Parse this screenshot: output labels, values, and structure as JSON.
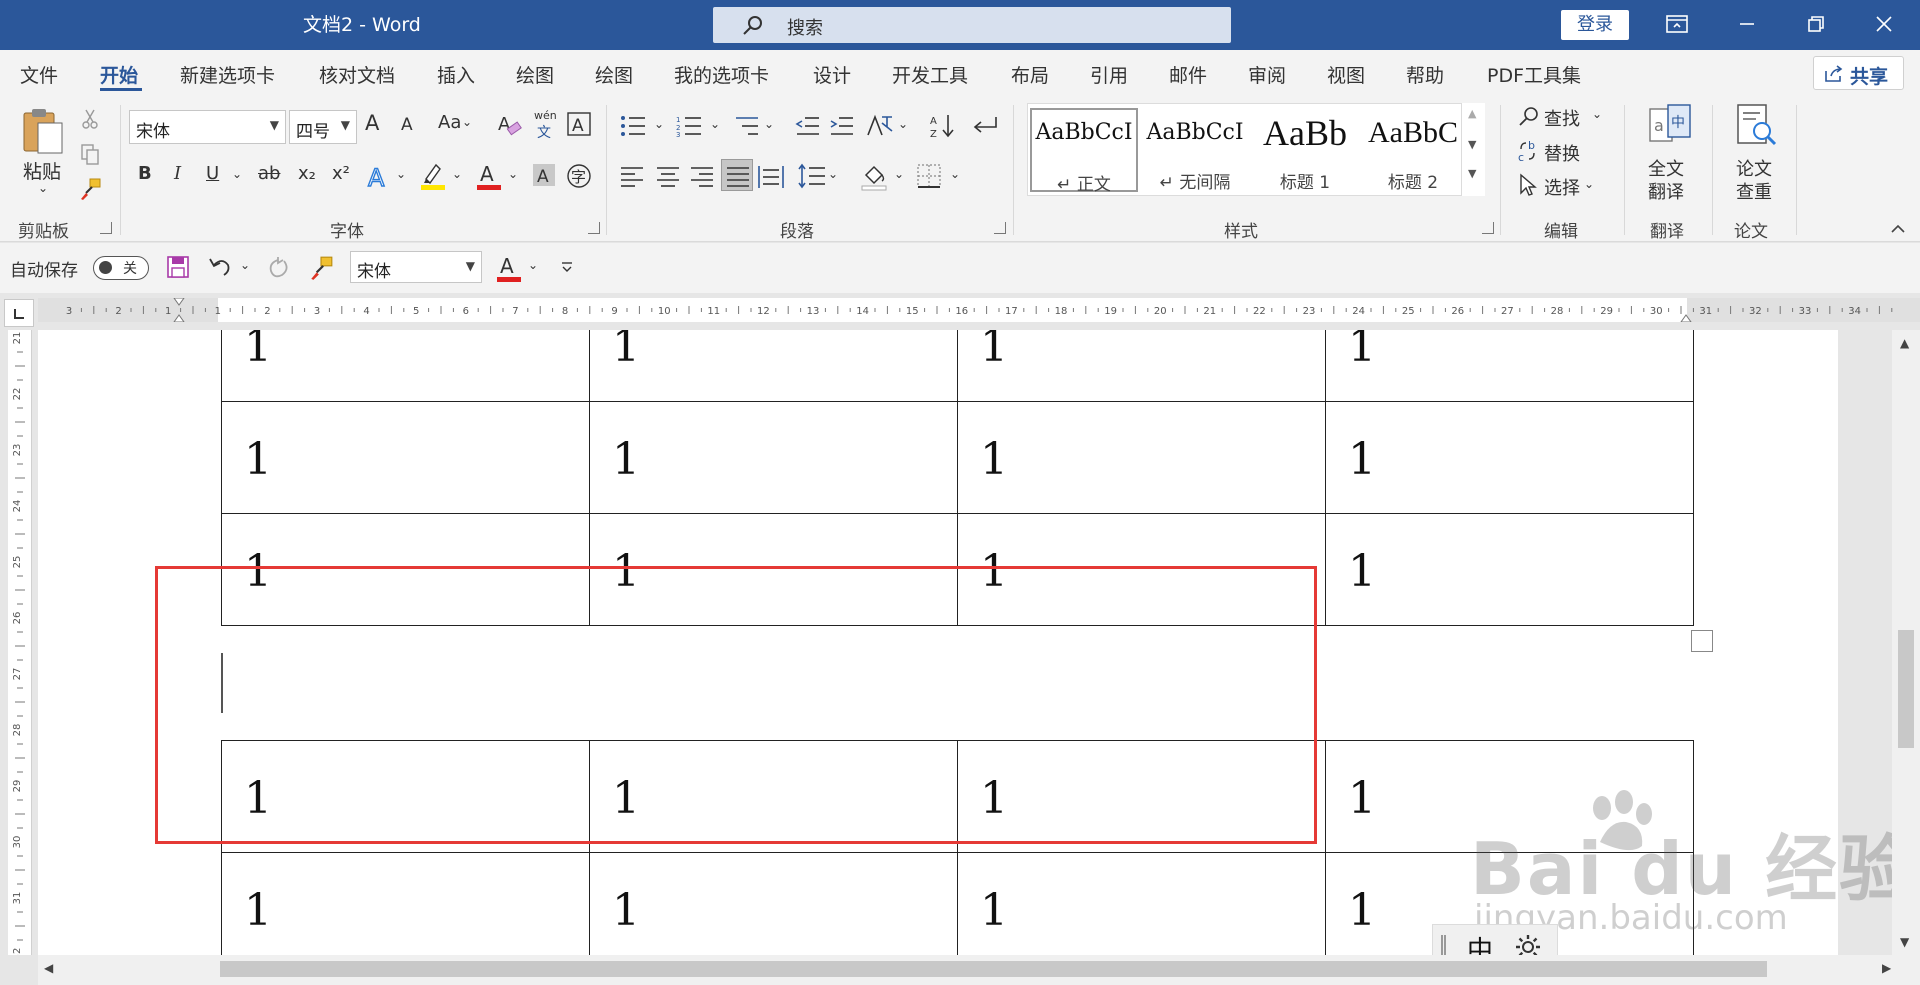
{
  "title_bar": {
    "doc_title": "文档2  -  Word",
    "search_placeholder": "搜索",
    "login_label": "登录"
  },
  "tabs": [
    "文件",
    "开始",
    "新建选项卡",
    "核对文档",
    "插入",
    "绘图",
    "绘图",
    "我的选项卡",
    "设计",
    "开发工具",
    "布局",
    "引用",
    "邮件",
    "审阅",
    "视图",
    "帮助",
    "PDF工具集"
  ],
  "active_tab": "开始",
  "share_label": "共享",
  "ribbon": {
    "clipboard": {
      "paste_label": "粘贴",
      "group_label": "剪贴板"
    },
    "font": {
      "font_name": "宋体",
      "font_size": "四号",
      "group_label": "字体",
      "bold": "B",
      "italic": "I",
      "underline": "U",
      "strike": "ab",
      "subscript": "x₂",
      "superscript": "x²",
      "change_case": "Aa",
      "grow": "A",
      "shrink": "A",
      "font_color_hex": "#e02020",
      "highlight_color_hex": "#ffe600",
      "pinyin": "wén",
      "pinyin_char": "文"
    },
    "paragraph": {
      "group_label": "段落"
    },
    "styles": {
      "group_label": "样式",
      "items": [
        {
          "sample": "AaBbCcI",
          "name": "↵ 正文"
        },
        {
          "sample": "AaBbCcI",
          "name": "↵ 无间隔"
        },
        {
          "sample": "AaBb",
          "name": "标题 1"
        },
        {
          "sample": "AaBbC",
          "name": "标题 2"
        }
      ]
    },
    "editing": {
      "find": "查找",
      "replace": "替换",
      "select": "选择",
      "group_label": "编辑"
    },
    "translate": {
      "label_line1": "全文",
      "label_line2": "翻译",
      "group_label": "翻译"
    },
    "thesis": {
      "label_line1": "论文",
      "label_line2": "查重",
      "group_label": "论文"
    }
  },
  "qat": {
    "autosave_label": "自动保存",
    "autosave_state": "关",
    "font_name": "宋体"
  },
  "document": {
    "table_top_rows": [
      [
        "1",
        "1",
        "1",
        "1"
      ],
      [
        "1",
        "1",
        "1",
        "1"
      ],
      [
        "1",
        "1",
        "1",
        "1"
      ]
    ],
    "table_bottom_rows": [
      [
        "1",
        "1",
        "1",
        "1"
      ],
      [
        "1",
        "1",
        "1",
        "1"
      ]
    ]
  },
  "hruler_ticks": [
    "3",
    "2",
    "1",
    "1",
    "2",
    "3",
    "4",
    "5",
    "6",
    "7",
    "8",
    "9",
    "10",
    "11",
    "12",
    "13",
    "14",
    "15",
    "16",
    "17",
    "18",
    "19",
    "20",
    "21",
    "22",
    "23",
    "24",
    "25",
    "26",
    "27",
    "28",
    "29",
    "30",
    "31",
    "32",
    "33",
    "34"
  ],
  "vruler_ticks": [
    "21",
    "22",
    "23",
    "24",
    "25",
    "26",
    "27",
    "28",
    "29",
    "30",
    "31",
    "32"
  ],
  "ime": {
    "mode": "中"
  },
  "watermark": {
    "brand": "Bai du 经验",
    "url": "jingyan.baidu.com"
  },
  "highlight_color_hex": "#e53935"
}
